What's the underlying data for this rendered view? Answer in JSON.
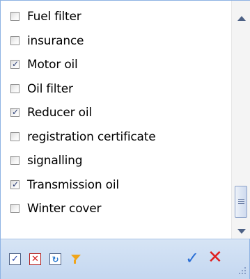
{
  "items": [
    {
      "label": "Fuel filter",
      "checked": false
    },
    {
      "label": "insurance",
      "checked": false
    },
    {
      "label": "Motor oil",
      "checked": true
    },
    {
      "label": "Oil filter",
      "checked": false
    },
    {
      "label": "Reducer oil",
      "checked": true
    },
    {
      "label": "registration certificate",
      "checked": false
    },
    {
      "label": "signalling",
      "checked": false
    },
    {
      "label": "Transmission oil",
      "checked": true
    },
    {
      "label": "Winter cover",
      "checked": false
    }
  ],
  "check_glyph": "✓",
  "footer": {
    "check_all_glyph": "✓",
    "uncheck_all_glyph": "✕",
    "invert_glyph": "↻",
    "ok_glyph": "✓",
    "cancel_glyph": "✕"
  },
  "icons": {
    "check_all": "check-all-icon",
    "uncheck_all": "uncheck-all-icon",
    "invert": "invert-selection-icon",
    "filter": "filter-icon",
    "ok": "ok-checkmark-icon",
    "cancel": "cancel-x-icon"
  },
  "colors": {
    "border": "#8db2e3",
    "footer_bg": "#d6e4f5",
    "ok": "#2b6fd6",
    "cancel": "#e02020",
    "filter": "#f0a51a"
  }
}
